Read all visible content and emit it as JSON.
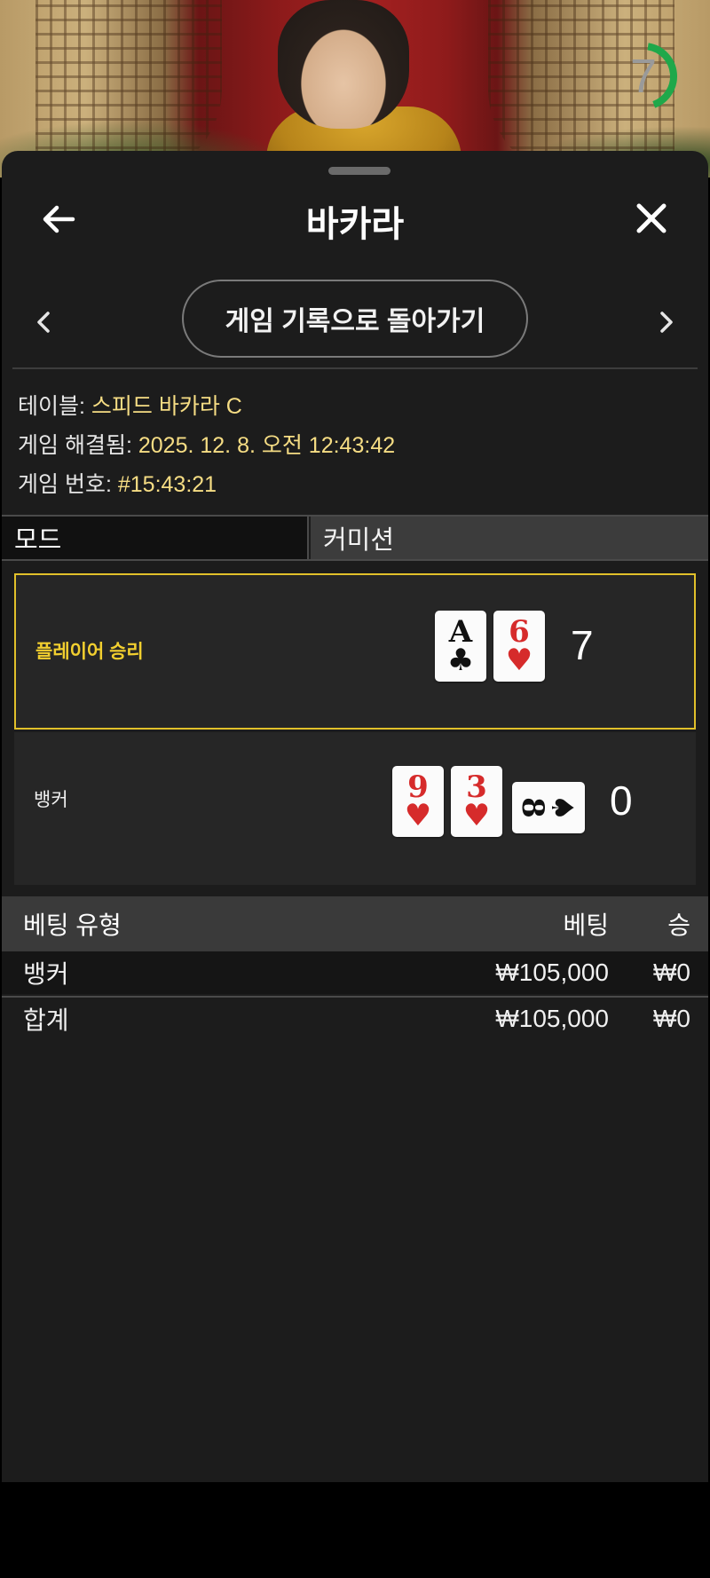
{
  "timer": {
    "value": "7",
    "fraction": 0.42,
    "color": "#1fa84a"
  },
  "header": {
    "title": "바카라"
  },
  "nav": {
    "return_label": "게임 기록으로 돌아가기"
  },
  "info": {
    "table_label": "테이블:",
    "table_value": "스피드 바카라 C",
    "resolved_label": "게임 해결됨:",
    "resolved_value": "2025. 12. 8. 오전 12:43:42",
    "game_no_label": "게임 번호:",
    "game_no_value": "#15:43:21"
  },
  "mode": {
    "label": "모드",
    "value": "커미션"
  },
  "player": {
    "label": "플레이어 승리",
    "score": "7",
    "cards": [
      {
        "rank": "A",
        "suit": "♣",
        "color": "black"
      },
      {
        "rank": "6",
        "suit": "♥",
        "color": "red"
      }
    ]
  },
  "banker": {
    "label": "뱅커",
    "score": "0",
    "cards": [
      {
        "rank": "9",
        "suit": "♥",
        "color": "red"
      },
      {
        "rank": "3",
        "suit": "♥",
        "color": "red"
      },
      {
        "rank": "8",
        "suit": "♠",
        "color": "black",
        "orientation": "sideways"
      }
    ]
  },
  "bets": {
    "headers": {
      "type": "베팅 유형",
      "bet": "베팅",
      "win": "승"
    },
    "rows": [
      {
        "type": "뱅커",
        "bet": "₩105,000",
        "win": "₩0"
      }
    ],
    "total": {
      "type": "합계",
      "bet": "₩105,000",
      "win": "₩0"
    }
  },
  "colors": {
    "accent_gold": "#e1c02a",
    "value_text": "#f6dd84",
    "timer_green": "#1fa84a"
  }
}
